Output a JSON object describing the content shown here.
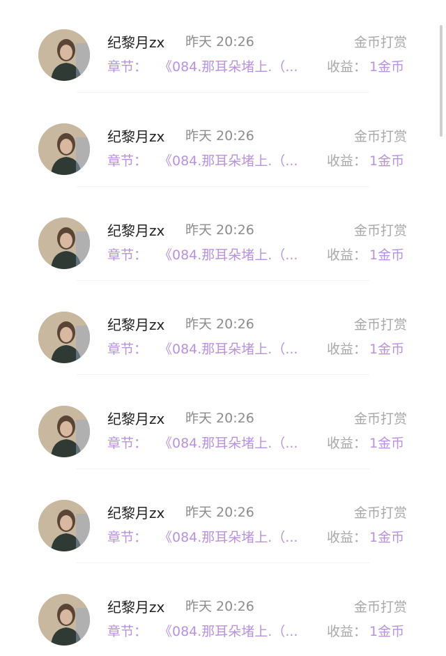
{
  "rows": [
    {
      "name": "纪黎月zx",
      "time": "昨天 20:26",
      "type": "金币打赏",
      "chapter_label": "章节：",
      "chapter_title": "《084.那耳朵堵上.（...",
      "income_label": "收益：",
      "income_value": "1金币"
    },
    {
      "name": "纪黎月zx",
      "time": "昨天 20:26",
      "type": "金币打赏",
      "chapter_label": "章节：",
      "chapter_title": "《084.那耳朵堵上.（...",
      "income_label": "收益：",
      "income_value": "1金币"
    },
    {
      "name": "纪黎月zx",
      "time": "昨天 20:26",
      "type": "金币打赏",
      "chapter_label": "章节：",
      "chapter_title": "《084.那耳朵堵上.（...",
      "income_label": "收益：",
      "income_value": "1金币"
    },
    {
      "name": "纪黎月zx",
      "time": "昨天 20:26",
      "type": "金币打赏",
      "chapter_label": "章节：",
      "chapter_title": "《084.那耳朵堵上.（...",
      "income_label": "收益：",
      "income_value": "1金币"
    },
    {
      "name": "纪黎月zx",
      "time": "昨天 20:26",
      "type": "金币打赏",
      "chapter_label": "章节：",
      "chapter_title": "《084.那耳朵堵上.（...",
      "income_label": "收益：",
      "income_value": "1金币"
    },
    {
      "name": "纪黎月zx",
      "time": "昨天 20:26",
      "type": "金币打赏",
      "chapter_label": "章节：",
      "chapter_title": "《084.那耳朵堵上.（...",
      "income_label": "收益：",
      "income_value": "1金币"
    },
    {
      "name": "纪黎月zx",
      "time": "昨天 20:26",
      "type": "金币打赏",
      "chapter_label": "章节：",
      "chapter_title": "《084.那耳朵堵上.（...",
      "income_label": "收益：",
      "income_value": "1金币"
    }
  ],
  "colors": {
    "accent": "#b892dc",
    "name": "#222222",
    "muted": "#a8a8a8"
  },
  "icons": {
    "avatar": "user-avatar-photo"
  }
}
